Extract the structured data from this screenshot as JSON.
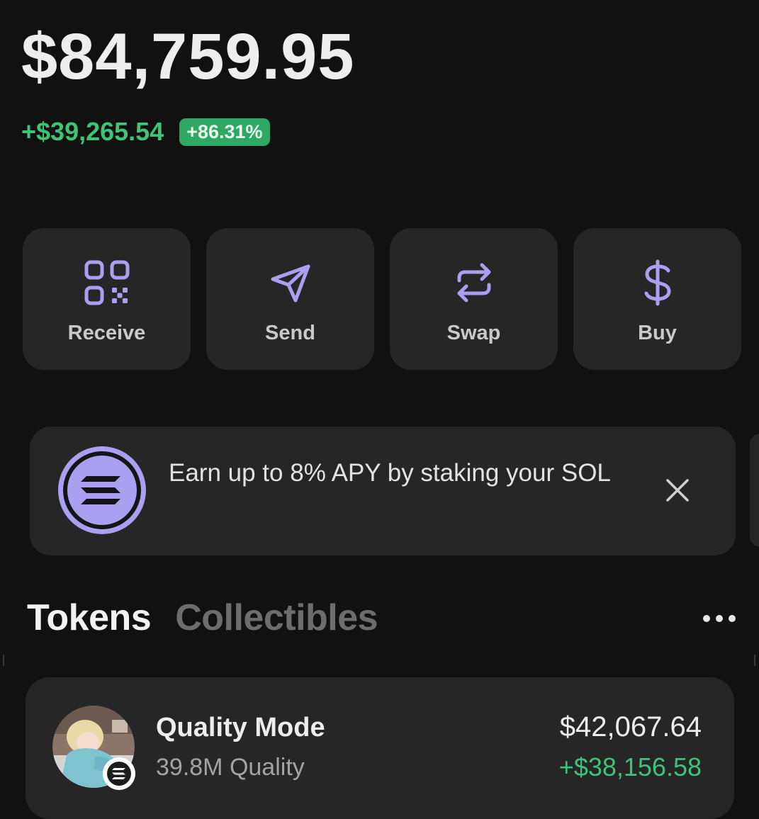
{
  "portfolio": {
    "balance": "$84,759.95",
    "change_amount": "+$39,265.54",
    "change_percent": "+86.31%"
  },
  "actions": [
    {
      "label": "Receive",
      "icon": "qr-code-icon"
    },
    {
      "label": "Send",
      "icon": "send-icon"
    },
    {
      "label": "Swap",
      "icon": "swap-icon"
    },
    {
      "label": "Buy",
      "icon": "dollar-icon"
    }
  ],
  "banner": {
    "text": "Earn up to 8% APY by staking your SOL",
    "icon": "solana-icon"
  },
  "tabs": [
    {
      "label": "Tokens",
      "active": true
    },
    {
      "label": "Collectibles",
      "active": false
    }
  ],
  "tokens": [
    {
      "name": "Quality Mode",
      "amount": "39.8M Quality",
      "value": "$42,067.64",
      "change": "+$38,156.58"
    }
  ],
  "colors": {
    "background": "#111111",
    "card": "#262626",
    "accent_purple": "#ab9ff2",
    "positive_green": "#3fc37a",
    "badge_green": "#2ea862"
  }
}
